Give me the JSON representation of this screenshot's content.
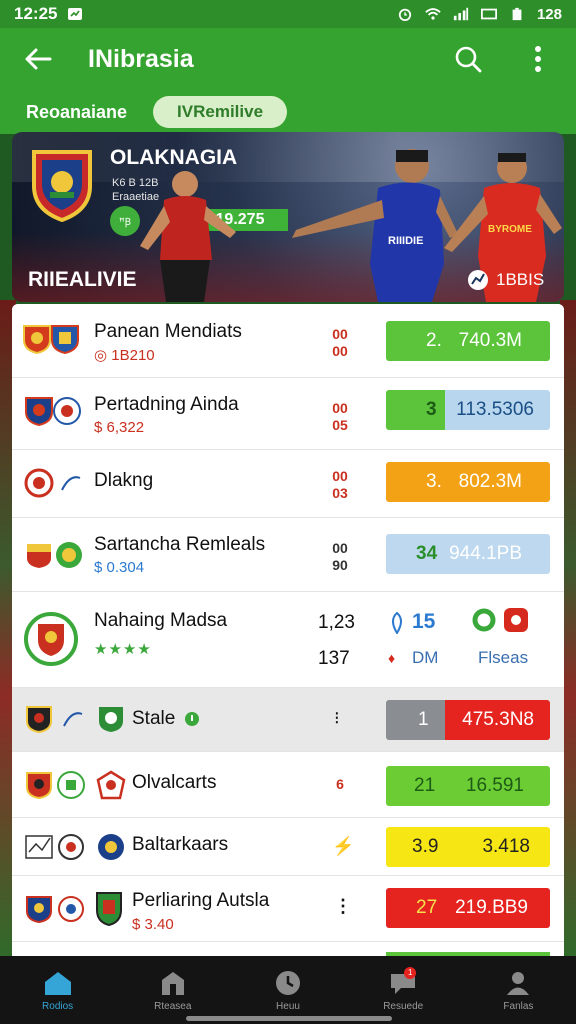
{
  "status_bar": {
    "time": "12:25",
    "battery": "128"
  },
  "app_bar": {
    "title": "INibrasia"
  },
  "tabs": [
    {
      "label": "Reoanaiane",
      "active": false
    },
    {
      "label": "IVRemilive",
      "active": true
    }
  ],
  "hero": {
    "title": "OLAKNAGIA",
    "sub_line1": "K6 B 12B",
    "sub_line2": "Eraaetiae",
    "badge": "ꟸꞴ",
    "score": "19.275",
    "live_label": "RIIEALIVIE",
    "count": "1BBIS",
    "player_shirt": "RIIIDIE",
    "player_shirt2": "BYROME"
  },
  "matches": [
    {
      "team": "Panean Mendiats",
      "sub": "1B210",
      "score_top": "00",
      "score_bot": "00",
      "odds_a": "2.",
      "odds_b": "740.3M",
      "odds_style": "green"
    },
    {
      "team": "Pertadning Ainda",
      "sub": "$ 6,322",
      "score_top": "00",
      "score_bot": "05",
      "odds_a": "3",
      "odds_b": "113.5306",
      "odds_style": "greenblue"
    },
    {
      "team": "Dlakng",
      "sub": "",
      "score_top": "00",
      "score_bot": "03",
      "odds_a": "3.",
      "odds_b": "802.3M",
      "odds_style": "orange"
    },
    {
      "team": "Sartancha Remleals",
      "sub": "$ 0.304",
      "score_top": "00",
      "score_bot": "90",
      "odds_a": "34",
      "odds_b": "944.1PB",
      "odds_style": "lightblue"
    },
    {
      "team": "Nahaing Madsa",
      "val_top": "1,23",
      "val_bot": "137",
      "blue_num": "15",
      "small_label": "DM",
      "right_label": "Flseas",
      "stars": "★★★★"
    },
    {
      "team": "Stale",
      "score_top": "",
      "score_bot": "",
      "odds_a": "1",
      "odds_b": "475.3N8",
      "odds_style": "greyred"
    },
    {
      "team": "Olvalcarts",
      "score_top": "",
      "score_bot": "6",
      "odds_a": "21",
      "odds_b": "16.591",
      "odds_style": "green2"
    },
    {
      "team": "Baltarkaars",
      "score_top": "",
      "score_bot": "",
      "odds_a": "3.9",
      "odds_b": "3.418",
      "odds_style": "yellow"
    },
    {
      "team": "Perliaring Autsla",
      "sub": "$ 3.40",
      "score_top": "",
      "score_bot": "",
      "odds_a": "27",
      "odds_b": "219.BB9",
      "odds_style": "red"
    }
  ],
  "bottom_nav": [
    {
      "label": "Rodios",
      "icon": "home-icon",
      "active": true
    },
    {
      "label": "Rteasea",
      "icon": "building-icon",
      "active": false
    },
    {
      "label": "Heuu",
      "icon": "clock-icon",
      "active": false
    },
    {
      "label": "Resuede",
      "icon": "chat-icon",
      "active": false,
      "badge": "1"
    },
    {
      "label": "Fanlas",
      "icon": "profile-icon",
      "active": false
    }
  ],
  "colors": {
    "primary_green": "#34a32f",
    "status_green": "#2e8f2a",
    "odds_green": "#5bc43a",
    "odds_orange": "#f3a215",
    "odds_red": "#e5231f",
    "odds_yellow": "#f5e614",
    "nav_active": "#34a5d6"
  }
}
